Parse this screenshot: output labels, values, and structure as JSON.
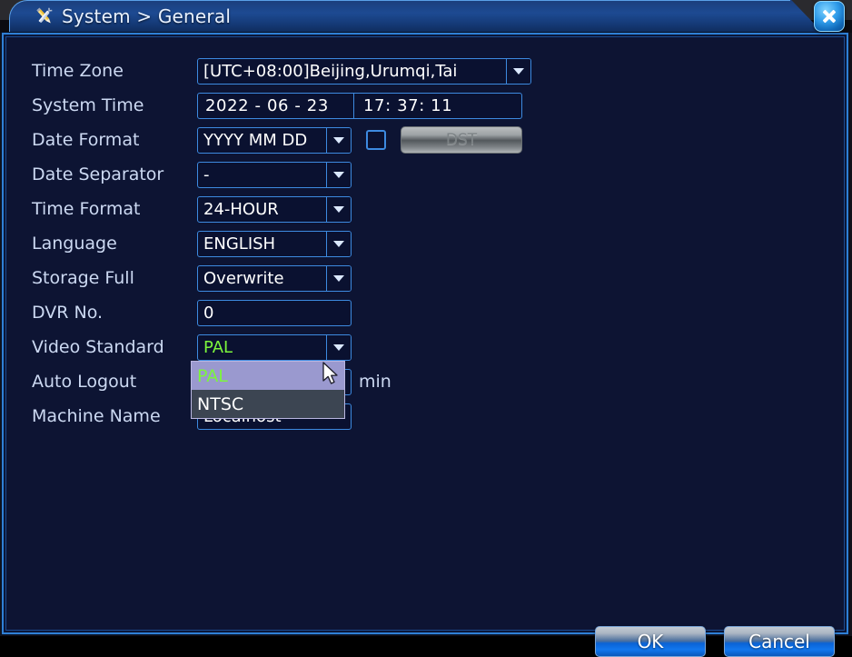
{
  "window": {
    "title": "System > General",
    "icon": "tools-icon",
    "close_label": "Close"
  },
  "colors": {
    "panel_bg": "#0d1433",
    "border_blue": "#2f7fd4",
    "field_border": "#3d8ae0",
    "label_text": "#ccd9f2",
    "value_text": "#ffffff",
    "green_value": "#7cf53c",
    "dropdown_selected_bg": "#9a99cf",
    "dropdown_option_bg": "#3c4552",
    "titlebar_blue": "#1d4a92"
  },
  "form": {
    "time_zone": {
      "label": "Time Zone",
      "value": "[UTC+08:00]Beijing,Urumqi,Tai"
    },
    "system_time": {
      "label": "System Time",
      "date": "2022 - 06 - 23",
      "time": "17: 37: 11"
    },
    "date_format": {
      "label": "Date Format",
      "value": "YYYY MM DD"
    },
    "dst": {
      "checked": false,
      "button_label": "DST"
    },
    "date_separator": {
      "label": "Date Separator",
      "value": "-"
    },
    "time_format": {
      "label": "Time Format",
      "value": "24-HOUR"
    },
    "language": {
      "label": "Language",
      "value": "ENGLISH"
    },
    "storage_full": {
      "label": "Storage Full",
      "value": "Overwrite"
    },
    "dvr_no": {
      "label": "DVR No.",
      "value": "0"
    },
    "video_standard": {
      "label": "Video Standard",
      "value": "PAL",
      "options": [
        {
          "label": "PAL",
          "selected": true
        },
        {
          "label": "NTSC",
          "selected": false
        }
      ]
    },
    "auto_logout": {
      "label": "Auto Logout",
      "suffix": "min"
    },
    "machine_name": {
      "label": "Machine Name",
      "value": "Localhost"
    }
  },
  "footer": {
    "ok_label": "OK",
    "cancel_label": "Cancel"
  }
}
